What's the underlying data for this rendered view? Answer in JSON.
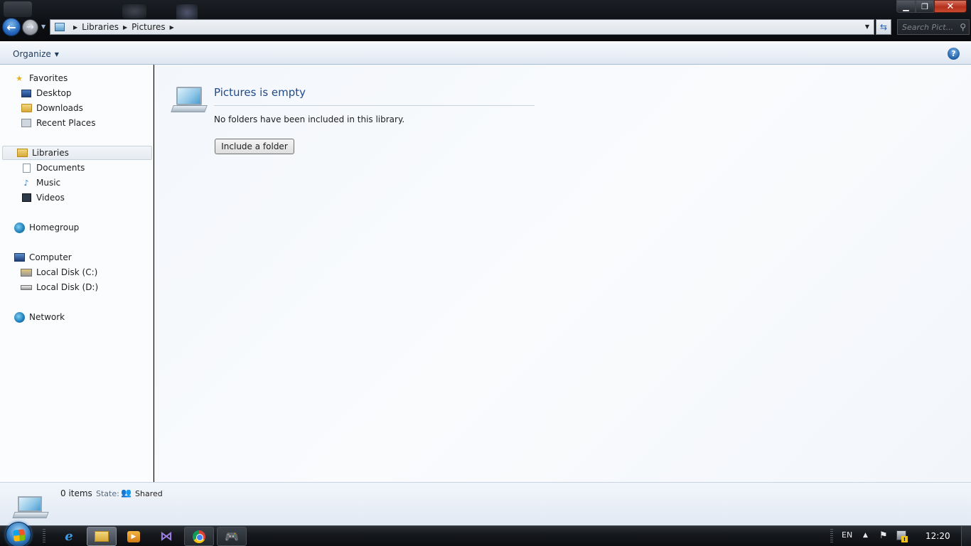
{
  "address": {
    "crumbs": [
      "Libraries",
      "Pictures"
    ],
    "search_placeholder": "Search Pict..."
  },
  "toolbar": {
    "organize_label": "Organize",
    "help_label": "?"
  },
  "nav": {
    "favorites": {
      "label": "Favorites",
      "items": [
        "Desktop",
        "Downloads",
        "Recent Places"
      ]
    },
    "libraries": {
      "label": "Libraries",
      "items": [
        "Documents",
        "Music",
        "Videos"
      ]
    },
    "homegroup": {
      "label": "Homegroup"
    },
    "computer": {
      "label": "Computer",
      "items": [
        "Local Disk (C:)",
        "Local Disk (D:)"
      ]
    },
    "network": {
      "label": "Network"
    }
  },
  "main": {
    "title": "Pictures is empty",
    "message": "No folders have been included in this library.",
    "include_button": "Include a folder"
  },
  "details": {
    "item_count": "0 items",
    "state_label": "State:",
    "state_value": "Shared"
  },
  "taskbar": {
    "language": "EN",
    "clock": "12:20"
  },
  "icons": {
    "back": "back-arrow-icon",
    "forward": "forward-arrow-icon",
    "refresh": "refresh-icon",
    "search": "magnifier-icon",
    "help": "help-icon",
    "favorites": "star-icon",
    "desktop": "desktop-icon",
    "downloads": "folder-icon",
    "recent": "recent-places-icon",
    "libraries": "library-icon",
    "documents": "document-icon",
    "music": "music-note-icon",
    "videos": "film-icon",
    "homegroup": "homegroup-icon",
    "computer": "computer-icon",
    "disk_c": "system-drive-icon",
    "disk_d": "drive-icon",
    "network": "network-icon",
    "library_empty": "pictures-library-icon",
    "shared": "shared-users-icon"
  },
  "colors": {
    "title_link": "#1e4a8c",
    "nav_selected": "#e6ebf1",
    "close_button": "#c84a30"
  }
}
